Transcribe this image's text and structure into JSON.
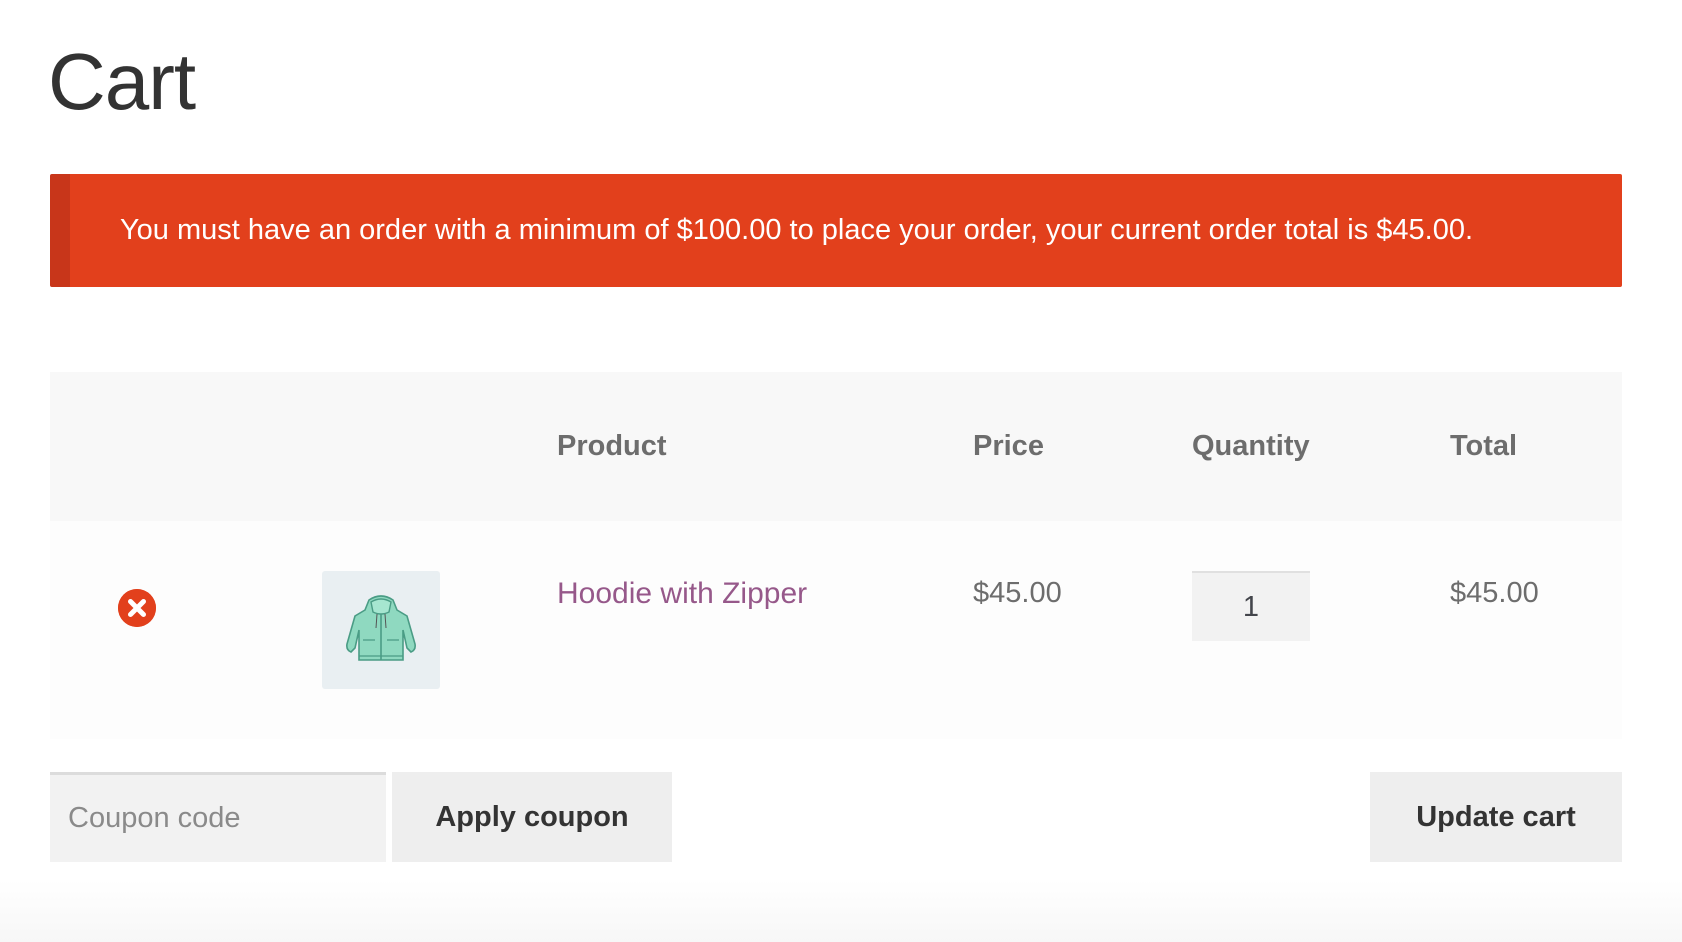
{
  "page": {
    "title": "Cart"
  },
  "notice": {
    "message": "You must have an order with a minimum of $100.00 to place your order, your current order total is $45.00.",
    "color": "#e2401c"
  },
  "table": {
    "headers": {
      "remove": "",
      "thumbnail": "",
      "product": "Product",
      "price": "Price",
      "quantity": "Quantity",
      "total": "Total"
    },
    "rows": [
      {
        "remove_icon": "remove-circle-icon",
        "thumbnail_icon": "hoodie-thumbnail",
        "product": "Hoodie with Zipper",
        "price": "$45.00",
        "quantity": "1",
        "total": "$45.00"
      }
    ]
  },
  "actions": {
    "coupon_placeholder": "Coupon code",
    "apply_coupon_label": "Apply coupon",
    "update_cart_label": "Update cart"
  },
  "colors": {
    "accent": "#e2401c",
    "link": "#96588a"
  }
}
